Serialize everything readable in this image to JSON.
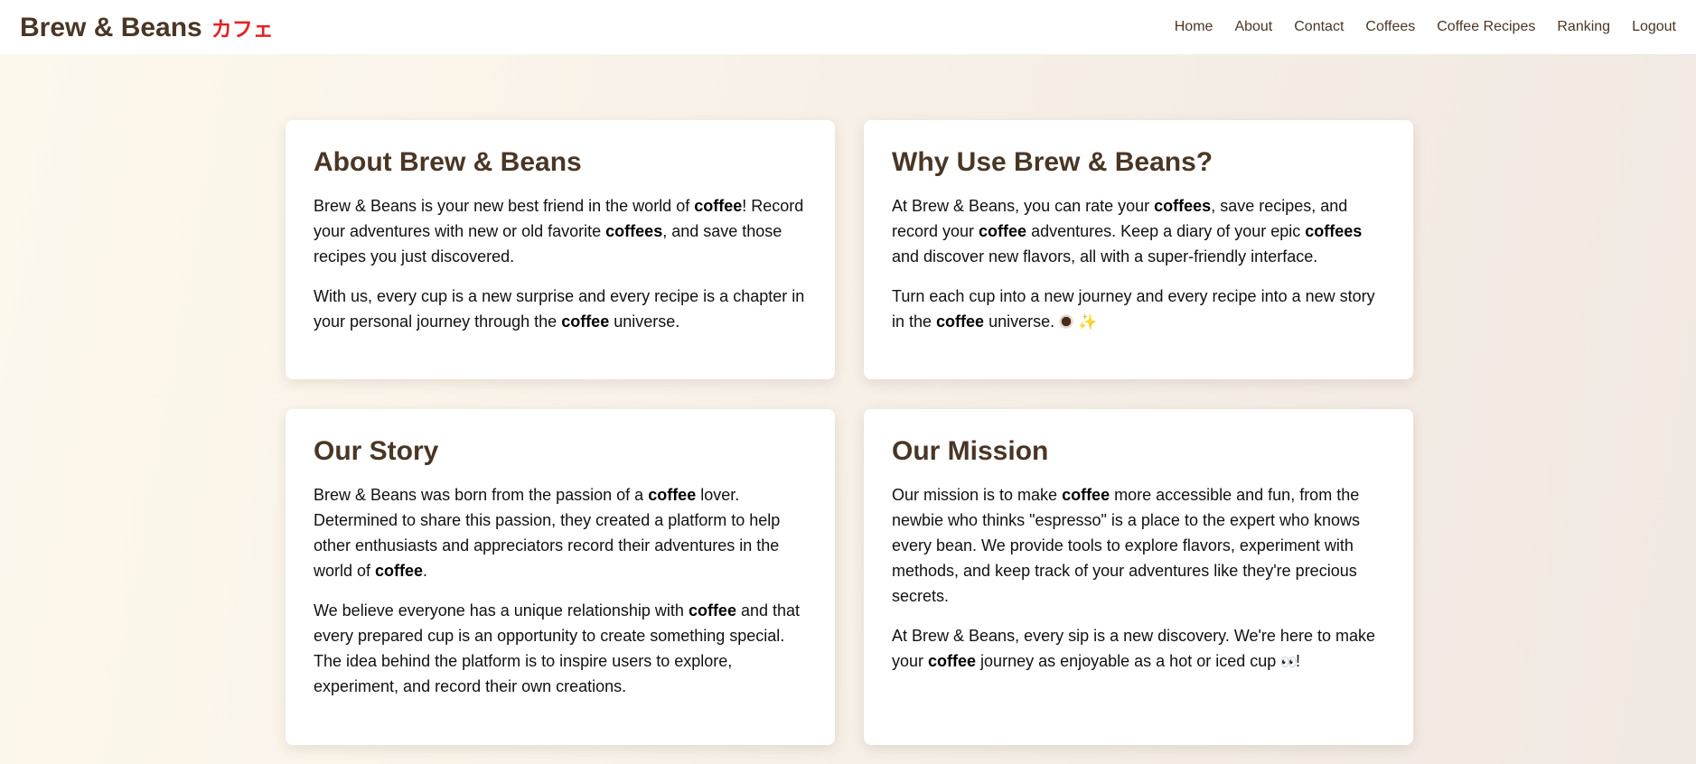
{
  "header": {
    "brand_name": "Brew & Beans",
    "brand_jp": "カフェ",
    "nav": [
      "Home",
      "About",
      "Contact",
      "Coffees",
      "Coffee Recipes",
      "Ranking",
      "Logout"
    ]
  },
  "cards": {
    "about": {
      "title": "About Brew & Beans",
      "p1": [
        {
          "t": "Brew & Beans is your new best friend in the world of "
        },
        {
          "t": "coffee",
          "b": true
        },
        {
          "t": "! Record your adventures with new or old favorite "
        },
        {
          "t": "coffees",
          "b": true
        },
        {
          "t": ", and save those recipes you just discovered."
        }
      ],
      "p2": [
        {
          "t": "With us, every cup is a new surprise and every recipe is a chapter in your personal journey through the "
        },
        {
          "t": "coffee",
          "b": true
        },
        {
          "t": " universe."
        }
      ]
    },
    "why": {
      "title": "Why Use Brew & Beans?",
      "p1": [
        {
          "t": "At Brew & Beans, you can rate your "
        },
        {
          "t": "coffees",
          "b": true
        },
        {
          "t": ", save recipes, and record your "
        },
        {
          "t": "coffee",
          "b": true
        },
        {
          "t": " adventures. Keep a diary of your epic "
        },
        {
          "t": "coffees",
          "b": true
        },
        {
          "t": " and discover new flavors, all with a super-friendly interface."
        }
      ],
      "p2": [
        {
          "t": "Turn each cup into a new journey and every recipe into a new story in the "
        },
        {
          "t": "coffee",
          "b": true
        },
        {
          "t": " universe. "
        }
      ],
      "p2_sparkle": "✨"
    },
    "story": {
      "title": "Our Story",
      "p1": [
        {
          "t": "Brew & Beans was born from the passion of a "
        },
        {
          "t": "coffee",
          "b": true
        },
        {
          "t": " lover. Determined to share this passion, they created a platform to help other enthusiasts and appreciators record their adventures in the world of "
        },
        {
          "t": "coffee",
          "b": true
        },
        {
          "t": "."
        }
      ],
      "p2": [
        {
          "t": "We believe everyone has a unique relationship with "
        },
        {
          "t": "coffee",
          "b": true
        },
        {
          "t": " and that every prepared cup is an opportunity to create something special. The idea behind the platform is to inspire users to explore, experiment, and record their own creations."
        }
      ]
    },
    "mission": {
      "title": "Our Mission",
      "p1": [
        {
          "t": "Our mission is to make "
        },
        {
          "t": "coffee",
          "b": true
        },
        {
          "t": " more accessible and fun, from the newbie who thinks \"espresso\" is a place to the expert who knows every bean. We provide tools to explore flavors, experiment with methods, and keep track of your adventures like they're precious secrets."
        }
      ],
      "p2": [
        {
          "t": "At Brew & Beans, every sip is a new discovery. We're here to make your "
        },
        {
          "t": "coffee",
          "b": true
        },
        {
          "t": " journey as enjoyable as a hot or iced cup "
        }
      ],
      "p2_eyes": "👀",
      "p2_end": "!"
    }
  },
  "colors": {
    "brand": "#4a3625",
    "brand_jp": "#e02424",
    "card_bg": "#ffffff",
    "page_bg_start": "#fdf8ec",
    "page_bg_end": "#f0e8e2"
  }
}
